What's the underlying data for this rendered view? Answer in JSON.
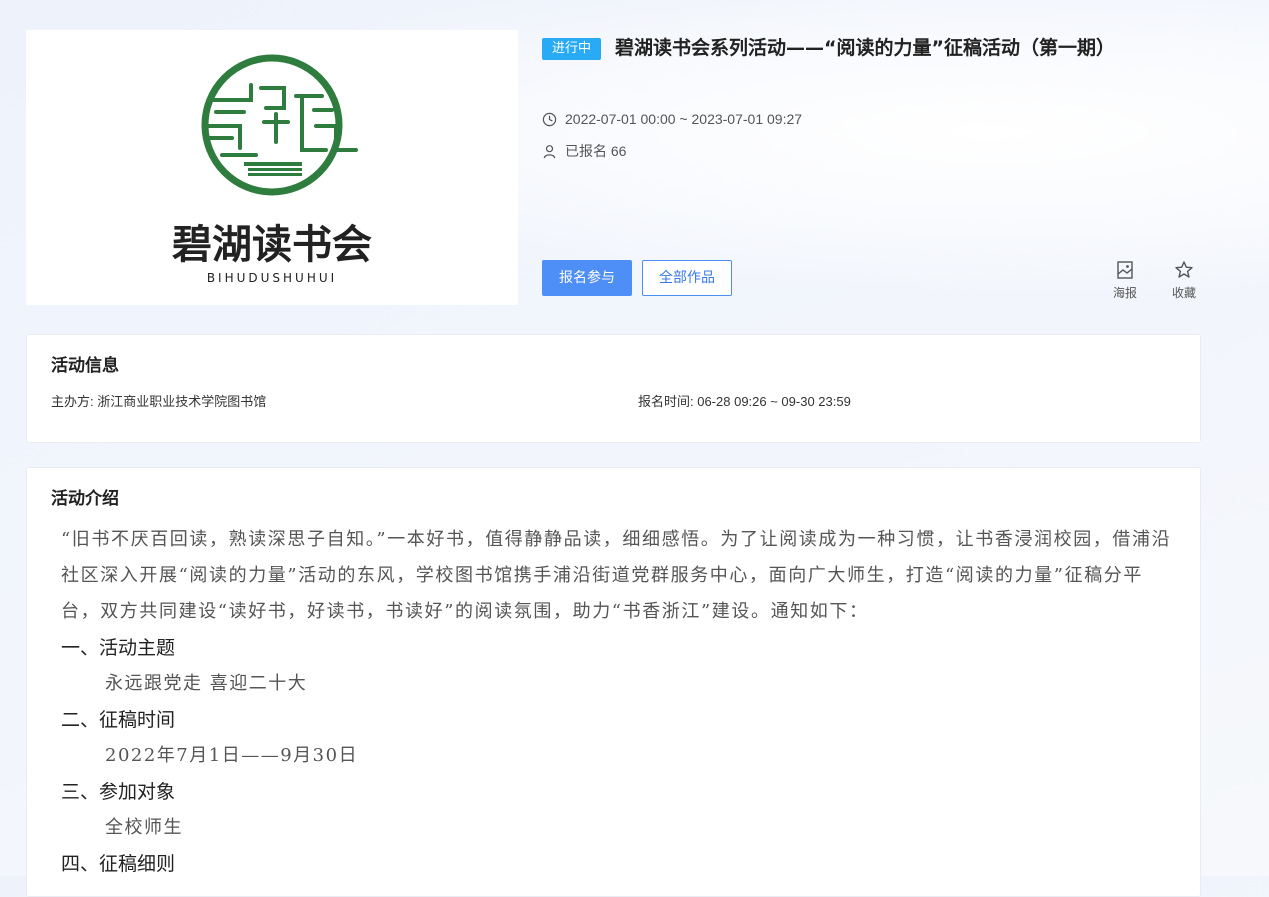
{
  "cover": {
    "logo_title": "碧湖读书会",
    "logo_pinyin": "BIHUDUSHUHUI"
  },
  "activity": {
    "status_badge": "进行中",
    "title": "碧湖读书会系列活动——“阅读的力量”征稿活动（第一期）",
    "time_range": "2022-07-01 00:00 ~ 2023-07-01 09:27",
    "signup_count": "已报名 66",
    "signup_button": "报名参与",
    "works_button": "全部作品",
    "poster_label": "海报",
    "favorite_label": "收藏"
  },
  "info_card": {
    "heading": "活动信息",
    "organizer": "主办方: 浙江商业职业技术学院图书馆",
    "signup_time": "报名时间: 06-28 09:26 ~ 09-30 23:59"
  },
  "intro_card": {
    "heading": "活动介绍",
    "paragraph": "“旧书不厌百回读，熟读深思子自知。”一本好书，值得静静品读，细细感悟。为了让阅读成为一种习惯，让书香浸润校园，借浦沿社区深入开展“阅读的力量”活动的东风，学校图书馆携手浦沿街道党群服务中心，面向广大师生，打造“阅读的力量”征稿分平台，双方共同建设“读好书，好读书，书读好”的阅读氛围，助力“书香浙江”建设。通知如下：",
    "sections": [
      {
        "heading": "一、活动主题",
        "text": "永远跟党走 喜迎二十大"
      },
      {
        "heading": "二、征稿时间",
        "text": "2022年7月1日——9月30日"
      },
      {
        "heading": "三、参加对象",
        "text": "全校师生"
      },
      {
        "heading": "四、征稿细则",
        "text": ""
      }
    ]
  },
  "colors": {
    "accent_blue": "#4e8ef7",
    "badge_blue": "#28aaf5",
    "logo_green": "#2e7d3f"
  }
}
